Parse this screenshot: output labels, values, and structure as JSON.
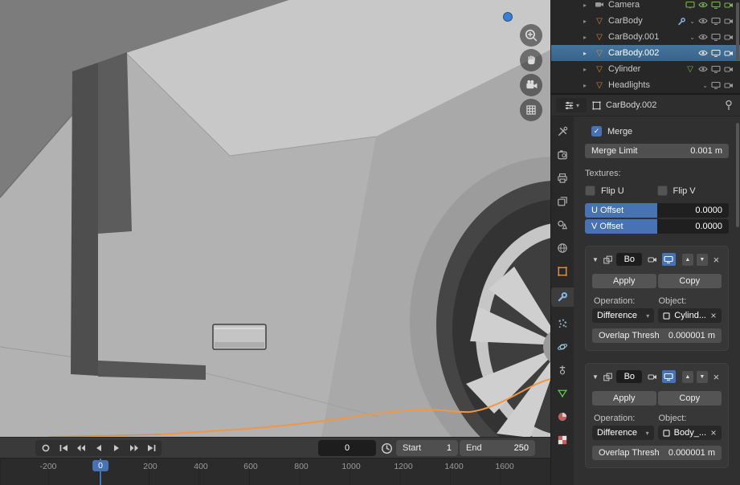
{
  "accent": "#4772b3",
  "outliner": {
    "rows": [
      {
        "label": "Camera"
      },
      {
        "label": "CarBody"
      },
      {
        "label": "CarBody.001"
      },
      {
        "label": "CarBody.002"
      },
      {
        "label": "Cylinder"
      },
      {
        "label": "Headlights"
      }
    ]
  },
  "properties": {
    "breadcrumb": "CarBody.002",
    "merge": {
      "label": "Merge"
    },
    "merge_limit": {
      "label": "Merge Limit",
      "value": "0.001 m"
    },
    "textures": {
      "heading": "Textures:",
      "flip_u": "Flip U",
      "flip_v": "Flip V",
      "u_offset": {
        "label": "U Offset",
        "value": "0.0000"
      },
      "v_offset": {
        "label": "V Offset",
        "value": "0.0000"
      }
    },
    "modifier1": {
      "name": "Bo",
      "apply": "Apply",
      "copy": "Copy",
      "operation_label": "Operation:",
      "object_label": "Object:",
      "operation": "Difference",
      "object": "Cylind...",
      "overlap_label": "Overlap Thresh",
      "overlap_value": "0.000001 m"
    },
    "modifier2": {
      "name": "Bo",
      "apply": "Apply",
      "copy": "Copy",
      "operation_label": "Operation:",
      "object_label": "Object:",
      "operation": "Difference",
      "object": "Body_...",
      "overlap_label": "Overlap Thresh",
      "overlap_value": "0.000001 m"
    }
  },
  "timeline": {
    "frame": "0",
    "current_frame": "0",
    "start_label": "Start",
    "start_value": "1",
    "end_label": "End",
    "end_value": "250",
    "ticks": [
      "-200",
      "0",
      "200",
      "400",
      "600",
      "800",
      "1000",
      "1200",
      "1400",
      "1600"
    ]
  },
  "icons": {
    "gizmos": [
      "zoom-icon",
      "hand-icon",
      "camera-view-icon",
      "grid-icon"
    ],
    "transport": [
      "record-icon",
      "jump-start-icon",
      "prev-keyframe-icon",
      "play-reverse-icon",
      "play-icon",
      "next-keyframe-icon",
      "jump-end-icon"
    ],
    "property_tabs": [
      "tool",
      "render",
      "output",
      "view-layer",
      "scene",
      "world",
      "object",
      "modifiers",
      "particles",
      "physics",
      "constraints",
      "object-data",
      "material",
      "texture"
    ]
  }
}
